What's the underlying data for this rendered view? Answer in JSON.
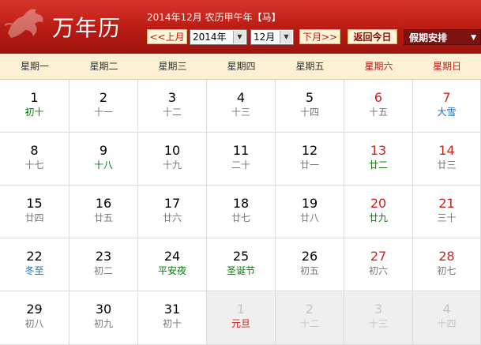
{
  "header": {
    "app_title": "万年历",
    "date_info": "2014年12月 农历甲午年【马】",
    "prev_month_label": "<<上月",
    "year_value": "2014年",
    "month_value": "12月",
    "next_month_label": "下月>>",
    "today_label": "返回今日",
    "holiday_label": "假期安排"
  },
  "weekdays": [
    "星期一",
    "星期二",
    "星期三",
    "星期四",
    "星期五",
    "星期六",
    "星期日"
  ],
  "days": [
    {
      "day": "1",
      "sub": "初十",
      "type": "fest",
      "weekend": false,
      "other": false
    },
    {
      "day": "2",
      "sub": "十一",
      "type": "lunar",
      "weekend": false,
      "other": false
    },
    {
      "day": "3",
      "sub": "十二",
      "type": "lunar",
      "weekend": false,
      "other": false
    },
    {
      "day": "4",
      "sub": "十三",
      "type": "lunar",
      "weekend": false,
      "other": false
    },
    {
      "day": "5",
      "sub": "十四",
      "type": "lunar",
      "weekend": false,
      "other": false
    },
    {
      "day": "6",
      "sub": "十五",
      "type": "lunar",
      "weekend": true,
      "other": false
    },
    {
      "day": "7",
      "sub": "大雪",
      "type": "term",
      "weekend": true,
      "other": false
    },
    {
      "day": "8",
      "sub": "十七",
      "type": "lunar",
      "weekend": false,
      "other": false
    },
    {
      "day": "9",
      "sub": "十八",
      "type": "fest",
      "weekend": false,
      "other": false
    },
    {
      "day": "10",
      "sub": "十九",
      "type": "lunar",
      "weekend": false,
      "other": false
    },
    {
      "day": "11",
      "sub": "二十",
      "type": "lunar",
      "weekend": false,
      "other": false
    },
    {
      "day": "12",
      "sub": "廿一",
      "type": "lunar",
      "weekend": false,
      "other": false
    },
    {
      "day": "13",
      "sub": "廿二",
      "type": "fest",
      "weekend": true,
      "other": false
    },
    {
      "day": "14",
      "sub": "廿三",
      "type": "lunar",
      "weekend": true,
      "other": false
    },
    {
      "day": "15",
      "sub": "廿四",
      "type": "lunar",
      "weekend": false,
      "other": false
    },
    {
      "day": "16",
      "sub": "廿五",
      "type": "lunar",
      "weekend": false,
      "other": false
    },
    {
      "day": "17",
      "sub": "廿六",
      "type": "lunar",
      "weekend": false,
      "other": false
    },
    {
      "day": "18",
      "sub": "廿七",
      "type": "lunar",
      "weekend": false,
      "other": false
    },
    {
      "day": "19",
      "sub": "廿八",
      "type": "lunar",
      "weekend": false,
      "other": false
    },
    {
      "day": "20",
      "sub": "廿九",
      "type": "fest",
      "weekend": true,
      "other": false
    },
    {
      "day": "21",
      "sub": "三十",
      "type": "lunar",
      "weekend": true,
      "other": false
    },
    {
      "day": "22",
      "sub": "冬至",
      "type": "term",
      "weekend": false,
      "other": false
    },
    {
      "day": "23",
      "sub": "初二",
      "type": "lunar",
      "weekend": false,
      "other": false
    },
    {
      "day": "24",
      "sub": "平安夜",
      "type": "fest",
      "weekend": false,
      "other": false
    },
    {
      "day": "25",
      "sub": "圣诞节",
      "type": "fest",
      "weekend": false,
      "other": false
    },
    {
      "day": "26",
      "sub": "初五",
      "type": "lunar",
      "weekend": false,
      "other": false
    },
    {
      "day": "27",
      "sub": "初六",
      "type": "lunar",
      "weekend": true,
      "other": false
    },
    {
      "day": "28",
      "sub": "初七",
      "type": "lunar",
      "weekend": true,
      "other": false
    },
    {
      "day": "29",
      "sub": "初八",
      "type": "lunar",
      "weekend": false,
      "other": false
    },
    {
      "day": "30",
      "sub": "初九",
      "type": "lunar",
      "weekend": false,
      "other": false
    },
    {
      "day": "31",
      "sub": "初十",
      "type": "lunar",
      "weekend": false,
      "other": false
    },
    {
      "day": "1",
      "sub": "元旦",
      "type": "holi",
      "weekend": false,
      "other": true
    },
    {
      "day": "2",
      "sub": "十二",
      "type": "lunar",
      "weekend": false,
      "other": true
    },
    {
      "day": "3",
      "sub": "十三",
      "type": "lunar",
      "weekend": false,
      "other": true
    },
    {
      "day": "4",
      "sub": "十四",
      "type": "lunar",
      "weekend": false,
      "other": true
    }
  ],
  "colors": {
    "header_red": "#b81b13",
    "weekend_red": "#d0201a",
    "festival_green": "#0a7a0a",
    "solar_term_blue": "#1f6fb8",
    "weekday_bar": "#fdf0d5"
  }
}
